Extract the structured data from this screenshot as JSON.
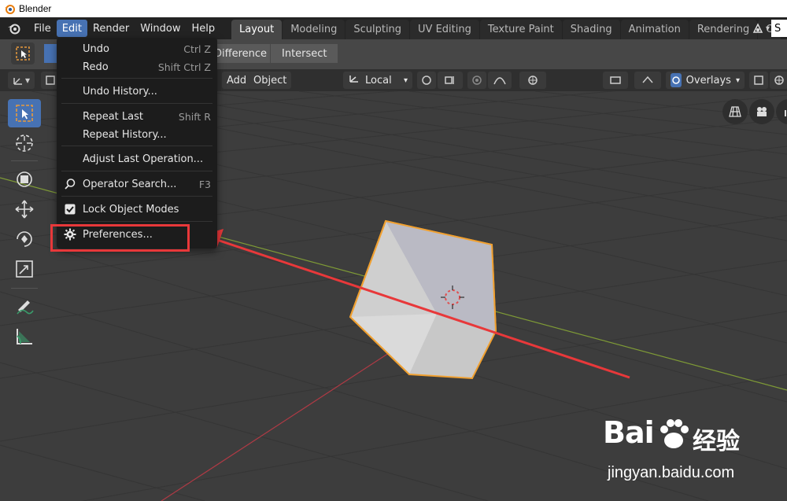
{
  "window": {
    "title": "Blender"
  },
  "menubar": {
    "items": [
      "File",
      "Edit",
      "Render",
      "Window",
      "Help"
    ],
    "active": "Edit"
  },
  "workspaces": {
    "tabs": [
      "Layout",
      "Modeling",
      "Sculpting",
      "UV Editing",
      "Texture Paint",
      "Shading",
      "Animation",
      "Rendering",
      "C"
    ],
    "active": "Layout",
    "scene_label": "S"
  },
  "tool_settings": {
    "boolean_modes": [
      "Difference",
      "Intersect"
    ]
  },
  "viewport_header": {
    "add": "Add",
    "object": "Object",
    "transform_orientation": "Local",
    "overlays": "Overlays"
  },
  "edit_menu": {
    "items": [
      {
        "label": "Undo",
        "shortcut": "Ctrl Z",
        "icon": ""
      },
      {
        "label": "Redo",
        "shortcut": "Shift Ctrl Z",
        "icon": ""
      },
      {
        "label": "Undo History...",
        "shortcut": "",
        "icon": ""
      },
      {
        "label": "Repeat Last",
        "shortcut": "Shift R",
        "icon": ""
      },
      {
        "label": "Repeat History...",
        "shortcut": "",
        "icon": ""
      },
      {
        "label": "Adjust Last Operation...",
        "shortcut": "",
        "icon": ""
      },
      {
        "label": "Operator Search...",
        "shortcut": "F3",
        "icon": "search-icon"
      },
      {
        "label": "Lock Object Modes",
        "shortcut": "",
        "icon": "checkbox-checked-icon"
      },
      {
        "label": "Preferences...",
        "shortcut": "",
        "icon": "gear-icon"
      }
    ]
  },
  "watermark": {
    "brand": "Bai",
    "brand_suffix": "经验",
    "url": "jingyan.baidu.com"
  },
  "colors": {
    "accent": "#4772b3",
    "highlight": "#e8383a",
    "axis_x": "#c8404a",
    "axis_y": "#8aa83a",
    "object_outline": "#f0a030"
  }
}
